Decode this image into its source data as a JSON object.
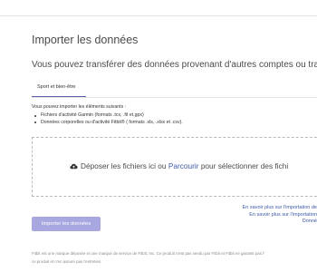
{
  "header": {
    "title": "Importer les données",
    "subtitle": "Vous pouvez transférer des données provenant d'autres comptes ou track"
  },
  "tabs": [
    {
      "label": "Sport et bien-être",
      "active": true
    }
  ],
  "info": {
    "intro": "Vous pouvez importer les éléments suivants :",
    "items": [
      "Fichiers d'activité Garmin (formats .tcx, .fit et.gpx)",
      "Données corporelles ou d'activité Fitbit® ( formats .xls, .xlsx et .csv)."
    ]
  },
  "dropzone": {
    "icon": "cloud-upload-icon",
    "text_before": "Déposer les fichiers ici ou ",
    "link": "Parcourir",
    "text_after": " pour sélectionner des fichi"
  },
  "help_links": [
    "En savoir plus sur l'importation de",
    "En savoir plus sur l'importation",
    "Donné"
  ],
  "actions": {
    "import_label": "Importer les données"
  },
  "footer": {
    "line1": "Fitbit est une marque déposée et une marque de service de Fitbit, Inc. Ce produit n'est pas vendu par Fitbit et Fitbit ne garantit pas l'",
    "line2": "ce produit et n'en assure pas l'entretien."
  },
  "colors": {
    "accent": "#5b5fa8",
    "link": "#3d5aa8",
    "button_bg": "#a9a7e0"
  }
}
